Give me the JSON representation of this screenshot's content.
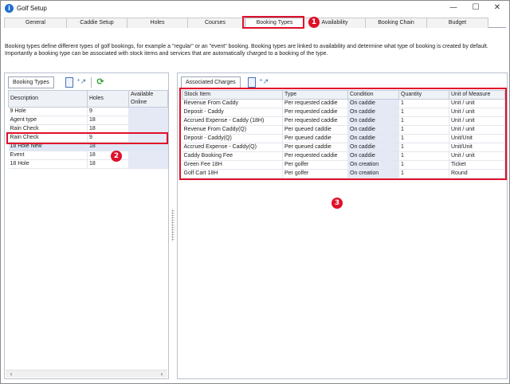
{
  "window": {
    "app_icon": "i",
    "title": "Golf Setup",
    "minimize_icon": "—",
    "maximize_icon": "☐",
    "close_icon": "✕"
  },
  "tabs": [
    {
      "label": "General"
    },
    {
      "label": "Caddie Setup"
    },
    {
      "label": "Holes"
    },
    {
      "label": "Courses"
    },
    {
      "label": "Booking Types",
      "active": true
    },
    {
      "label": "Availability"
    },
    {
      "label": "Booking Chain"
    },
    {
      "label": "Budget"
    }
  ],
  "description": "Booking types define different types of golf bookings, for example a \"regular\" or an \"event\" booking. Booking types are linked to availability and determine what type of booking is created by default. Importantly a booking type can be associated with stock items and services that are automatically charged to a booking of the type.",
  "markers": {
    "one": "1",
    "two": "2",
    "three": "3"
  },
  "booking_types": {
    "title": "Booking Types",
    "columns": [
      "Description",
      "Holes",
      "Available Online"
    ],
    "rows": [
      {
        "description": "9 Hole",
        "holes": "9",
        "online": ""
      },
      {
        "description": "Agent type",
        "holes": "18",
        "online": ""
      },
      {
        "description": "Rain Check",
        "holes": "18",
        "online": ""
      },
      {
        "description": "Rain Check",
        "holes": "9",
        "online": ""
      },
      {
        "description": "18 Hole New",
        "holes": "18",
        "online": "",
        "selected": true
      },
      {
        "description": "Event",
        "holes": "18",
        "online": ""
      },
      {
        "description": "18 Hole",
        "holes": "18",
        "online": ""
      }
    ],
    "scroll_left": "‹",
    "scroll_right": "›"
  },
  "associated_charges": {
    "title": "Associated Charges",
    "columns": [
      "Stock Item",
      "Type",
      "Condition",
      "Quantity",
      "Unit of Measure"
    ],
    "rows": [
      {
        "item": "Revenue From Caddy",
        "type": "Per requested caddie",
        "condition": "On caddie",
        "quantity": "1",
        "unit": "Unit / unit"
      },
      {
        "item": "Deposit - Caddy",
        "type": "Per requested caddie",
        "condition": "On caddie",
        "quantity": "1",
        "unit": "Unit / unit"
      },
      {
        "item": "Accrued Expense - Caddy (18H)",
        "type": "Per requested caddie",
        "condition": "On caddie",
        "quantity": "1",
        "unit": "Unit / unit"
      },
      {
        "item": "Revenue From Caddy(Q)",
        "type": "Per queued caddie",
        "condition": "On caddie",
        "quantity": "1",
        "unit": "Unit / unit"
      },
      {
        "item": "Deposit - Caddy(Q)",
        "type": "Per queued caddie",
        "condition": "On caddie",
        "quantity": "1",
        "unit": "Unit/Unit"
      },
      {
        "item": "Accrued Expense - Caddy(Q)",
        "type": "Per queued caddie",
        "condition": "On caddie",
        "quantity": "1",
        "unit": "Unit/Unit"
      },
      {
        "item": "Caddy Booking Fee",
        "type": "Per requested caddie",
        "condition": "On caddie",
        "quantity": "1",
        "unit": "Unit / unit"
      },
      {
        "item": "Green Fee 18H",
        "type": "Per golfer",
        "condition": "On creation",
        "quantity": "1",
        "unit": "Ticket"
      },
      {
        "item": "Golf Cart 18H",
        "type": "Per golfer",
        "condition": "On creation",
        "quantity": "1",
        "unit": "Round"
      }
    ]
  },
  "icons": {
    "new_doc": "",
    "add_link": "⁺↗",
    "refresh": "⟳"
  },
  "colors": {
    "highlight": "#e0102a",
    "accent": "#1e6fd0"
  }
}
